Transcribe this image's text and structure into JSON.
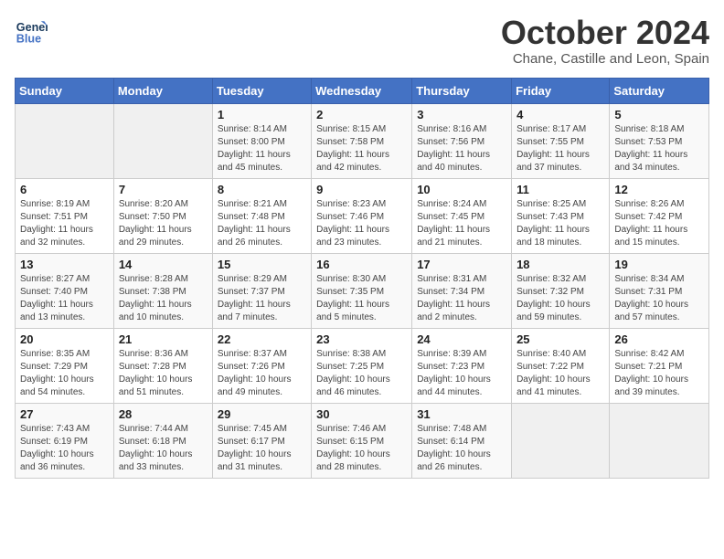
{
  "header": {
    "logo_line1": "General",
    "logo_line2": "Blue",
    "title": "October 2024",
    "subtitle": "Chane, Castille and Leon, Spain"
  },
  "weekdays": [
    "Sunday",
    "Monday",
    "Tuesday",
    "Wednesday",
    "Thursday",
    "Friday",
    "Saturday"
  ],
  "weeks": [
    [
      {
        "day": "",
        "info": ""
      },
      {
        "day": "",
        "info": ""
      },
      {
        "day": "1",
        "info": "Sunrise: 8:14 AM\nSunset: 8:00 PM\nDaylight: 11 hours and 45 minutes."
      },
      {
        "day": "2",
        "info": "Sunrise: 8:15 AM\nSunset: 7:58 PM\nDaylight: 11 hours and 42 minutes."
      },
      {
        "day": "3",
        "info": "Sunrise: 8:16 AM\nSunset: 7:56 PM\nDaylight: 11 hours and 40 minutes."
      },
      {
        "day": "4",
        "info": "Sunrise: 8:17 AM\nSunset: 7:55 PM\nDaylight: 11 hours and 37 minutes."
      },
      {
        "day": "5",
        "info": "Sunrise: 8:18 AM\nSunset: 7:53 PM\nDaylight: 11 hours and 34 minutes."
      }
    ],
    [
      {
        "day": "6",
        "info": "Sunrise: 8:19 AM\nSunset: 7:51 PM\nDaylight: 11 hours and 32 minutes."
      },
      {
        "day": "7",
        "info": "Sunrise: 8:20 AM\nSunset: 7:50 PM\nDaylight: 11 hours and 29 minutes."
      },
      {
        "day": "8",
        "info": "Sunrise: 8:21 AM\nSunset: 7:48 PM\nDaylight: 11 hours and 26 minutes."
      },
      {
        "day": "9",
        "info": "Sunrise: 8:23 AM\nSunset: 7:46 PM\nDaylight: 11 hours and 23 minutes."
      },
      {
        "day": "10",
        "info": "Sunrise: 8:24 AM\nSunset: 7:45 PM\nDaylight: 11 hours and 21 minutes."
      },
      {
        "day": "11",
        "info": "Sunrise: 8:25 AM\nSunset: 7:43 PM\nDaylight: 11 hours and 18 minutes."
      },
      {
        "day": "12",
        "info": "Sunrise: 8:26 AM\nSunset: 7:42 PM\nDaylight: 11 hours and 15 minutes."
      }
    ],
    [
      {
        "day": "13",
        "info": "Sunrise: 8:27 AM\nSunset: 7:40 PM\nDaylight: 11 hours and 13 minutes."
      },
      {
        "day": "14",
        "info": "Sunrise: 8:28 AM\nSunset: 7:38 PM\nDaylight: 11 hours and 10 minutes."
      },
      {
        "day": "15",
        "info": "Sunrise: 8:29 AM\nSunset: 7:37 PM\nDaylight: 11 hours and 7 minutes."
      },
      {
        "day": "16",
        "info": "Sunrise: 8:30 AM\nSunset: 7:35 PM\nDaylight: 11 hours and 5 minutes."
      },
      {
        "day": "17",
        "info": "Sunrise: 8:31 AM\nSunset: 7:34 PM\nDaylight: 11 hours and 2 minutes."
      },
      {
        "day": "18",
        "info": "Sunrise: 8:32 AM\nSunset: 7:32 PM\nDaylight: 10 hours and 59 minutes."
      },
      {
        "day": "19",
        "info": "Sunrise: 8:34 AM\nSunset: 7:31 PM\nDaylight: 10 hours and 57 minutes."
      }
    ],
    [
      {
        "day": "20",
        "info": "Sunrise: 8:35 AM\nSunset: 7:29 PM\nDaylight: 10 hours and 54 minutes."
      },
      {
        "day": "21",
        "info": "Sunrise: 8:36 AM\nSunset: 7:28 PM\nDaylight: 10 hours and 51 minutes."
      },
      {
        "day": "22",
        "info": "Sunrise: 8:37 AM\nSunset: 7:26 PM\nDaylight: 10 hours and 49 minutes."
      },
      {
        "day": "23",
        "info": "Sunrise: 8:38 AM\nSunset: 7:25 PM\nDaylight: 10 hours and 46 minutes."
      },
      {
        "day": "24",
        "info": "Sunrise: 8:39 AM\nSunset: 7:23 PM\nDaylight: 10 hours and 44 minutes."
      },
      {
        "day": "25",
        "info": "Sunrise: 8:40 AM\nSunset: 7:22 PM\nDaylight: 10 hours and 41 minutes."
      },
      {
        "day": "26",
        "info": "Sunrise: 8:42 AM\nSunset: 7:21 PM\nDaylight: 10 hours and 39 minutes."
      }
    ],
    [
      {
        "day": "27",
        "info": "Sunrise: 7:43 AM\nSunset: 6:19 PM\nDaylight: 10 hours and 36 minutes."
      },
      {
        "day": "28",
        "info": "Sunrise: 7:44 AM\nSunset: 6:18 PM\nDaylight: 10 hours and 33 minutes."
      },
      {
        "day": "29",
        "info": "Sunrise: 7:45 AM\nSunset: 6:17 PM\nDaylight: 10 hours and 31 minutes."
      },
      {
        "day": "30",
        "info": "Sunrise: 7:46 AM\nSunset: 6:15 PM\nDaylight: 10 hours and 28 minutes."
      },
      {
        "day": "31",
        "info": "Sunrise: 7:48 AM\nSunset: 6:14 PM\nDaylight: 10 hours and 26 minutes."
      },
      {
        "day": "",
        "info": ""
      },
      {
        "day": "",
        "info": ""
      }
    ]
  ]
}
